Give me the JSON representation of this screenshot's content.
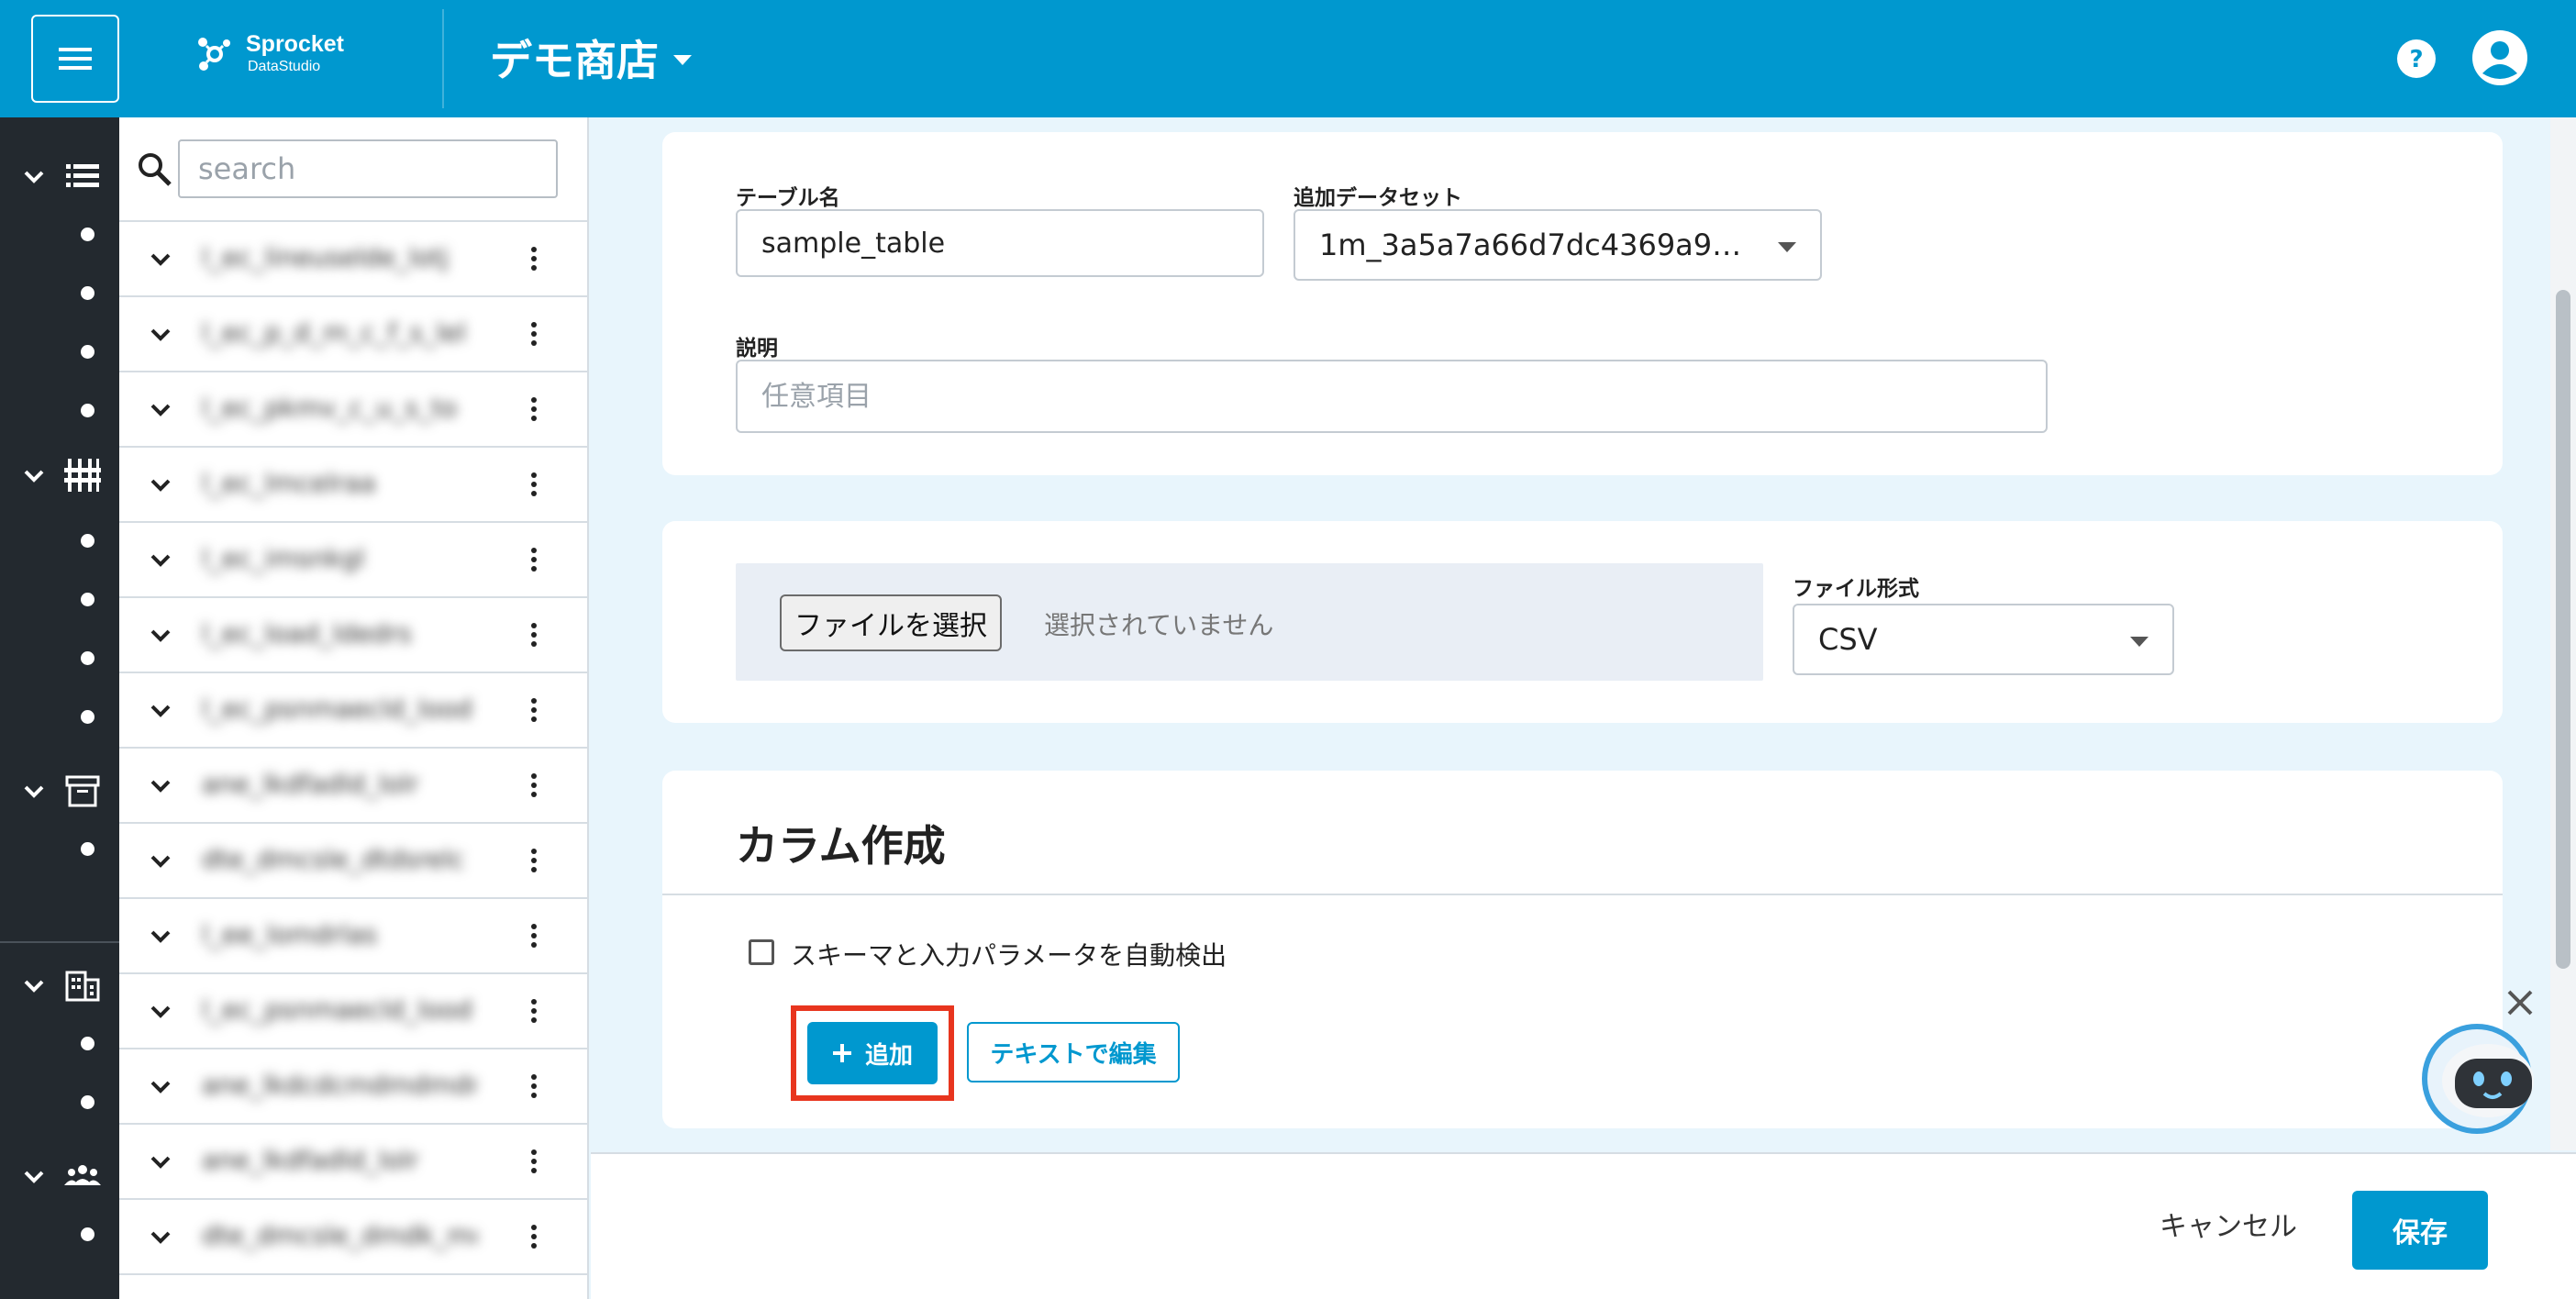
{
  "header": {
    "logo_name": "Sprocket",
    "logo_sub": "DataStudio",
    "store_title": "デモ商店"
  },
  "search": {
    "placeholder": "search"
  },
  "table_list": {
    "items": [
      {
        "name": "l_ec_lineuselde_lotj"
      },
      {
        "name": "l_ec_p_d_m_c_f_s_lel"
      },
      {
        "name": "l_ec_pkmv_c_u_s_to"
      },
      {
        "name": "l_ec_lmcelraa"
      },
      {
        "name": "l_ec_imsnkgl"
      },
      {
        "name": "l_ec_load_ldedrs"
      },
      {
        "name": "l_ec_psnmaecld_lood"
      },
      {
        "name": "ane_lkdfadld_lolr"
      },
      {
        "name": "dte_dmcsle_dtdsrelc"
      },
      {
        "name": "l_ee_lomdrlas"
      },
      {
        "name": "l_ec_psnmaecld_lood"
      },
      {
        "name": "ane_lkdcdcmdmdmdm"
      },
      {
        "name": "ane_lkdfadld_lolr"
      },
      {
        "name": "dte_dmcsle_dmdk_md"
      }
    ]
  },
  "form": {
    "table_name_label": "テーブル名",
    "table_name_value": "sample_table",
    "dataset_label": "追加データセット",
    "dataset_value": "1m_3a5a7a66d7dc4369a9…",
    "description_label": "説明",
    "description_placeholder": "任意項目",
    "file_button_label": "ファイルを選択",
    "file_status": "選択されていません",
    "file_format_label": "ファイル形式",
    "file_format_value": "CSV"
  },
  "columns": {
    "title": "カラム作成",
    "autodetect_label": "スキーマと入力パラメータを自動検出",
    "add_button_label": "追加",
    "edit_text_button_label": "テキストで編集"
  },
  "footer": {
    "cancel_label": "キャンセル",
    "save_label": "保存"
  },
  "colors": {
    "brand": "#0098cf",
    "rail": "#23292f",
    "highlight": "#e8351e",
    "background": "#e8f5fc"
  },
  "icons": {
    "menu": "menu-icon",
    "help": "help-circle-icon",
    "account": "account-circle-icon",
    "search": "search-icon",
    "chatbot": "robot-icon"
  }
}
